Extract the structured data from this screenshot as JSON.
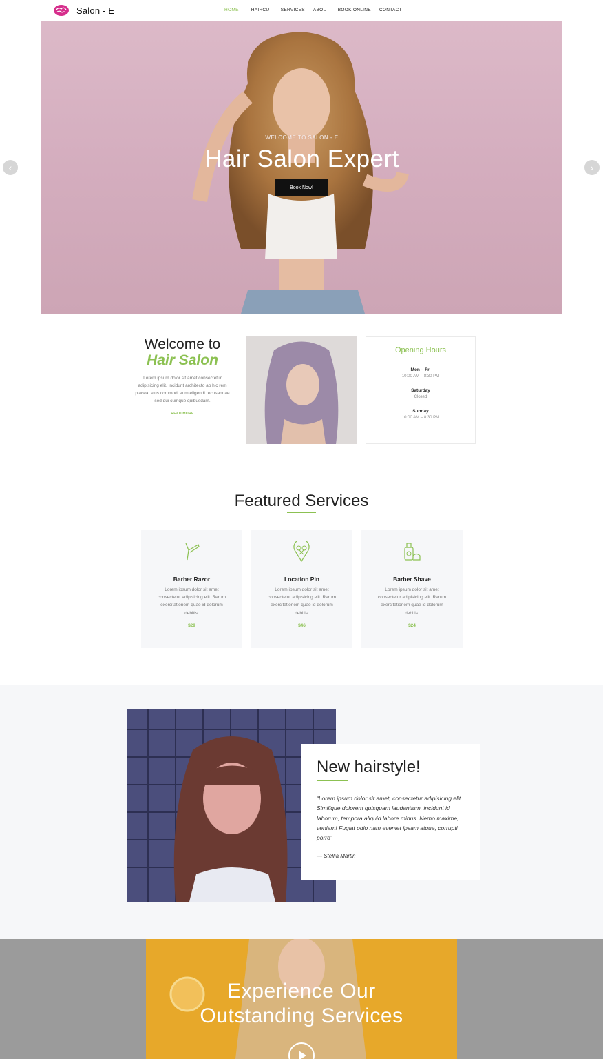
{
  "brand": {
    "name": "Salon - E",
    "logo_icon": "brain-icon",
    "logo_color": "#d62e8c"
  },
  "nav": {
    "items": [
      {
        "label": "HOME",
        "active": true
      },
      {
        "label": "HAIRCUT",
        "active": false
      },
      {
        "label": "SERVICES",
        "active": false
      },
      {
        "label": "ABOUT",
        "active": false
      },
      {
        "label": "BOOK ONLINE",
        "active": false
      },
      {
        "label": "CONTACT",
        "active": false
      }
    ]
  },
  "hero": {
    "kicker": "WELCOME TO SALON - E",
    "title": "Hair Salon Expert",
    "button": "Book Now!",
    "prev_icon": "chevron-left-icon",
    "next_icon": "chevron-right-icon"
  },
  "welcome": {
    "title": "Welcome to",
    "subtitle": "Hair Salon",
    "text": "Lorem ipsum dolor sit amet consectetur adipisicing elit. Incidunt architecto ab hic rem placeat eius commodi eum eligendi recusandae sed qui cumque quibusdam.",
    "read_more": "READ MORE"
  },
  "hours": {
    "title": "Opening Hours",
    "entries": [
      {
        "day": "Mon – Fri",
        "time": "10:00 AM – 8:30 PM"
      },
      {
        "day": "Saturday",
        "time": "Closed"
      },
      {
        "day": "Sunday",
        "time": "10:00 AM – 8:30 PM"
      }
    ]
  },
  "featured": {
    "title": "Featured Services",
    "cards": [
      {
        "icon": "razor-icon",
        "name": "Barber Razor",
        "desc": "Lorem ipsum dolor sit amet consectetur adipisicing elit. Rerum exercitationem quae id dolorum debitis.",
        "price": "$29"
      },
      {
        "icon": "location-pin-scissors-icon",
        "name": "Location Pin",
        "desc": "Lorem ipsum dolor sit amet consectetur adipisicing elit. Rerum exercitationem quae id dolorum debitis.",
        "price": "$46"
      },
      {
        "icon": "shave-bottle-icon",
        "name": "Barber Shave",
        "desc": "Lorem ipsum dolor sit amet consectetur adipisicing elit. Rerum exercitationem quae id dolorum debitis.",
        "price": "$24"
      }
    ]
  },
  "hairstyle": {
    "title": "New hairstyle!",
    "quote": "“Lorem ipsum dolor sit amet, consectetur adipisicing elit. Similique dolorem quisquam laudantium, incidunt id laborum, tempora aliquid labore minus. Nemo maxime, veniam! Fugiat odio nam eveniet ipsam atque, corrupti porro”",
    "author": "— Stellia Martin"
  },
  "experience": {
    "line1": "Experience Our",
    "line2": "Outstanding Services",
    "play_icon": "play-icon"
  },
  "colors": {
    "accent": "#8cc152",
    "text": "#222222",
    "muted": "#777777",
    "section_bg": "#f6f7f9"
  }
}
